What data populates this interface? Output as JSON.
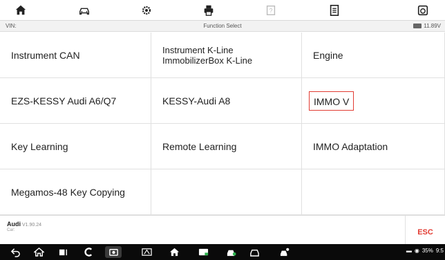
{
  "toolbar": {
    "icons": [
      "home-icon",
      "vehicle-swap-icon",
      "settings-icon",
      "print-icon",
      "help-icon",
      "datalog-icon",
      "snapshot-icon"
    ]
  },
  "header": {
    "vin_label": "VIN:",
    "title": "Function Select",
    "battery_voltage": "11.89V"
  },
  "functions": [
    {
      "label": "Instrument CAN"
    },
    {
      "label": "Instrument K-Line\nImmobilizerBox K-Line"
    },
    {
      "label": "Engine"
    },
    {
      "label": "EZS-KESSY Audi A6/Q7"
    },
    {
      "label": "KESSY-Audi A8"
    },
    {
      "label": "IMMO V",
      "highlighted": true
    },
    {
      "label": "Key Learning"
    },
    {
      "label": "Remote Learning"
    },
    {
      "label": "IMMO Adaptation"
    },
    {
      "label": "Megamos-48 Key Copying"
    },
    {
      "label": ""
    },
    {
      "label": ""
    }
  ],
  "footer": {
    "make": "Audi",
    "version": "V1.90.24",
    "car_label": "Car:",
    "esc_label": "ESC"
  },
  "navbar": {
    "status_battery": "35%",
    "status_time": "9:5"
  },
  "colors": {
    "accent": "#e23b32",
    "nav_bg": "#0a0a0a"
  }
}
